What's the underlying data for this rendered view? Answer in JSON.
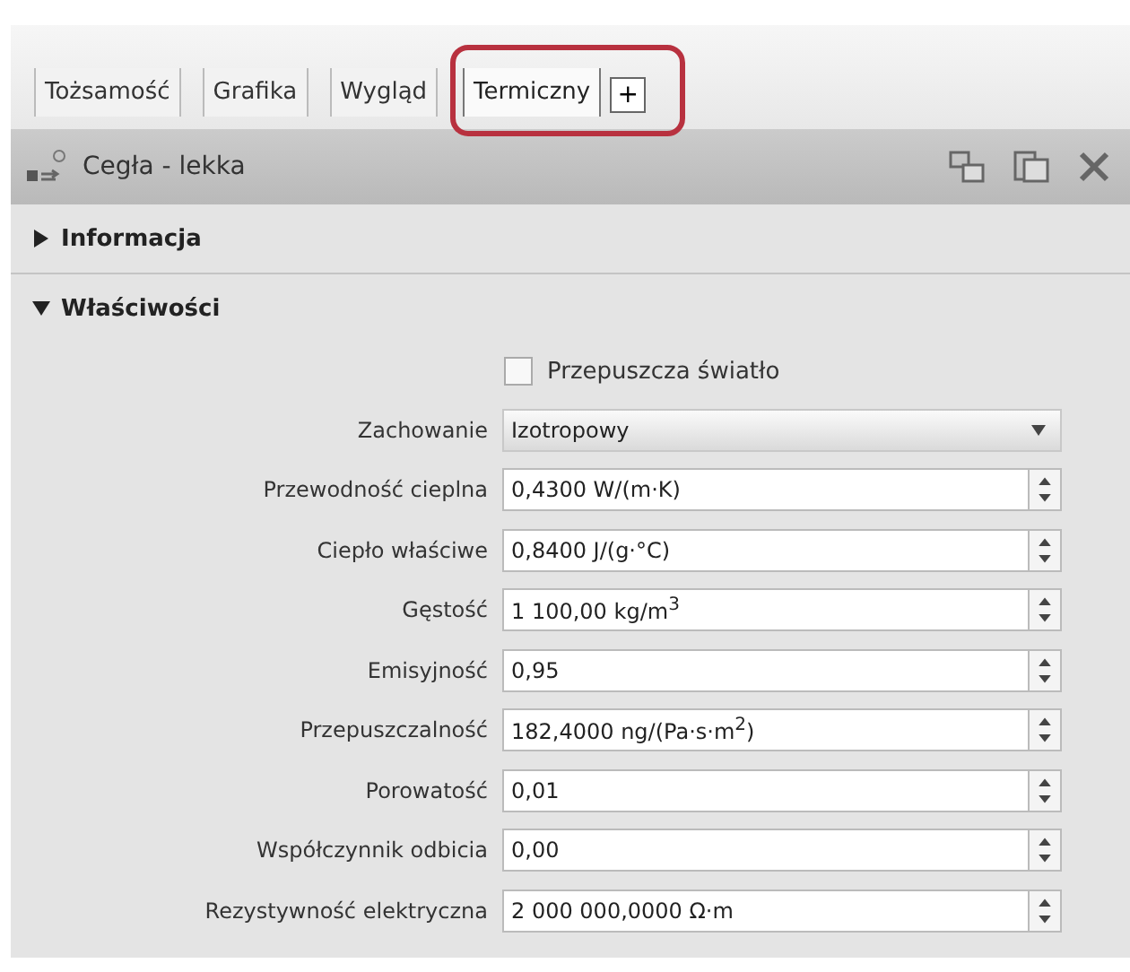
{
  "tabs": [
    {
      "label": "Tożsamość",
      "selected": false,
      "highlighted": false
    },
    {
      "label": "Grafika",
      "selected": false,
      "highlighted": false
    },
    {
      "label": "Wygląd",
      "selected": false,
      "highlighted": false
    },
    {
      "label": "Termiczny",
      "selected": true,
      "highlighted": true
    }
  ],
  "add_tab": "+",
  "header": {
    "title": "Cegła - lekka"
  },
  "sections": [
    {
      "title": "Informacja",
      "expanded": false
    },
    {
      "title": "Właściwości",
      "expanded": true
    }
  ],
  "checkbox": {
    "label": "Przepuszcza światło",
    "checked": false
  },
  "properties": [
    {
      "kind": "dropdown",
      "label": "Zachowanie",
      "value": "Izotropowy"
    },
    {
      "kind": "spinner",
      "label": "Przewodność cieplna",
      "value": "0,4300 W/(m·K)"
    },
    {
      "kind": "spinner",
      "label": "Ciepło właściwe",
      "value": "0,8400 J/(g·°C)"
    },
    {
      "kind": "spinner",
      "label": "Gęstość",
      "value": "1 100,00 kg/m$^{3}$"
    },
    {
      "kind": "spinner",
      "label": "Emisyjność",
      "value": "0,95"
    },
    {
      "kind": "spinner",
      "label": "Przepuszczalność",
      "value": "182,4000 ng/(Pa·s·m$^{2}$)"
    },
    {
      "kind": "spinner",
      "label": "Porowatość",
      "value": "0,01"
    },
    {
      "kind": "spinner",
      "label": "Współczynnik odbicia",
      "value": "0,00"
    },
    {
      "kind": "spinner",
      "label": "Rezystywność elektryczna",
      "value": "2 000 000,0000 Ω·m"
    }
  ]
}
